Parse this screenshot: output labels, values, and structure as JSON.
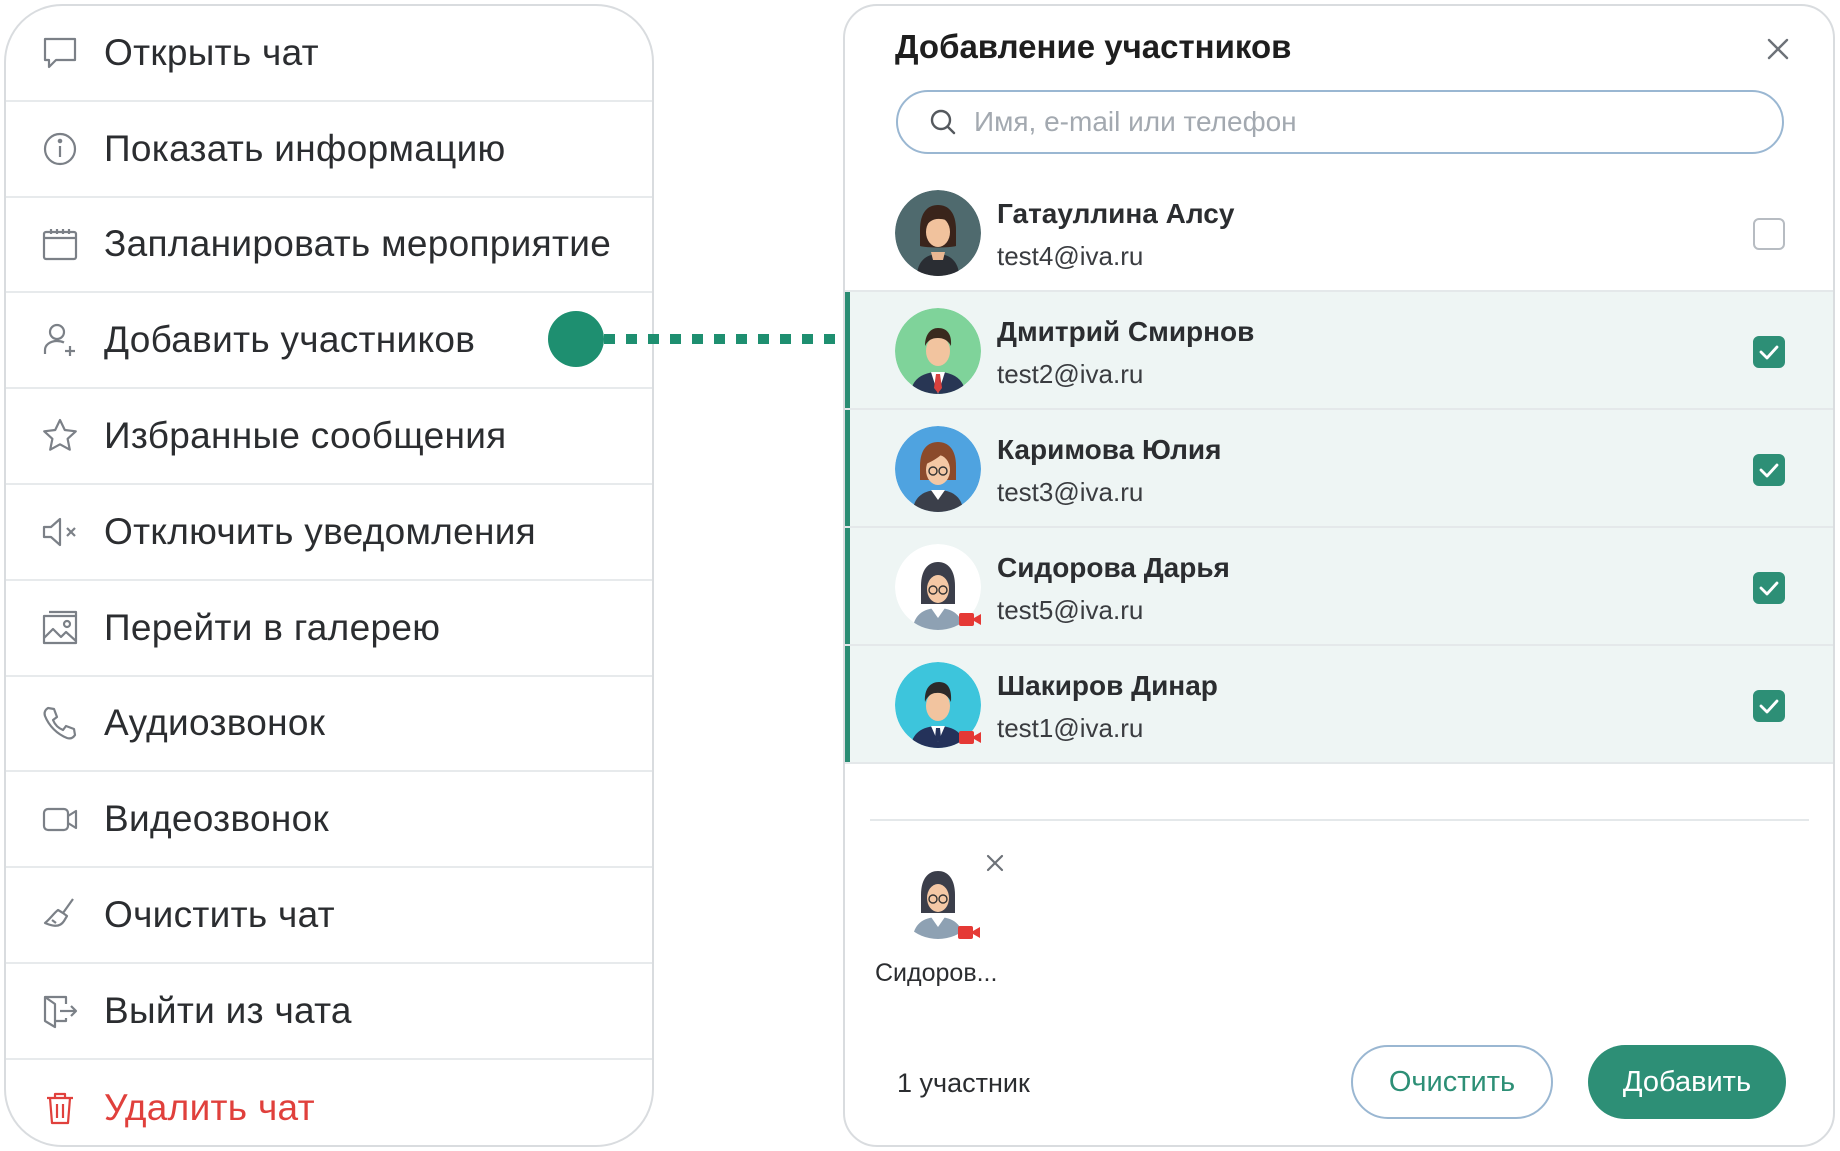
{
  "menu": {
    "items": [
      {
        "label": "Открыть чат",
        "icon": "chat-bubble-icon"
      },
      {
        "label": "Показать информацию",
        "icon": "info-icon"
      },
      {
        "label": "Запланировать мероприятие",
        "icon": "calendar-icon"
      },
      {
        "label": "Добавить участников",
        "icon": "add-user-icon"
      },
      {
        "label": "Избранные сообщения",
        "icon": "star-icon"
      },
      {
        "label": "Отключить уведомления",
        "icon": "mute-icon"
      },
      {
        "label": "Перейти в галерею",
        "icon": "gallery-icon"
      },
      {
        "label": "Аудиозвонок",
        "icon": "phone-icon"
      },
      {
        "label": "Видеозвонок",
        "icon": "video-icon"
      },
      {
        "label": "Очистить чат",
        "icon": "broom-icon"
      },
      {
        "label": "Выйти из чата",
        "icon": "exit-icon"
      },
      {
        "label": "Удалить чат",
        "icon": "trash-icon",
        "danger": true
      }
    ]
  },
  "dialog": {
    "title": "Добавление участников",
    "search_placeholder": "Имя, e-mail или телефон",
    "contacts": [
      {
        "name": "Гатауллина Алсу",
        "email": "test4@iva.ru",
        "checked": false
      },
      {
        "name": "Дмитрий Смирнов",
        "email": "test2@iva.ru",
        "checked": true
      },
      {
        "name": "Каримова Юлия",
        "email": "test3@iva.ru",
        "checked": true
      },
      {
        "name": "Сидорова Дарья",
        "email": "test5@iva.ru",
        "checked": true
      },
      {
        "name": "Шакиров Динар",
        "email": "test1@iva.ru",
        "checked": true
      }
    ],
    "selected_chip": {
      "name": "Сидоров..."
    },
    "count_label": "1 участник",
    "clear_label": "Очистить",
    "add_label": "Добавить"
  },
  "colors": {
    "accent": "#2d8f76",
    "connector": "#1e8f70",
    "danger": "#e0403c",
    "selected_row": "#eef5f4"
  }
}
